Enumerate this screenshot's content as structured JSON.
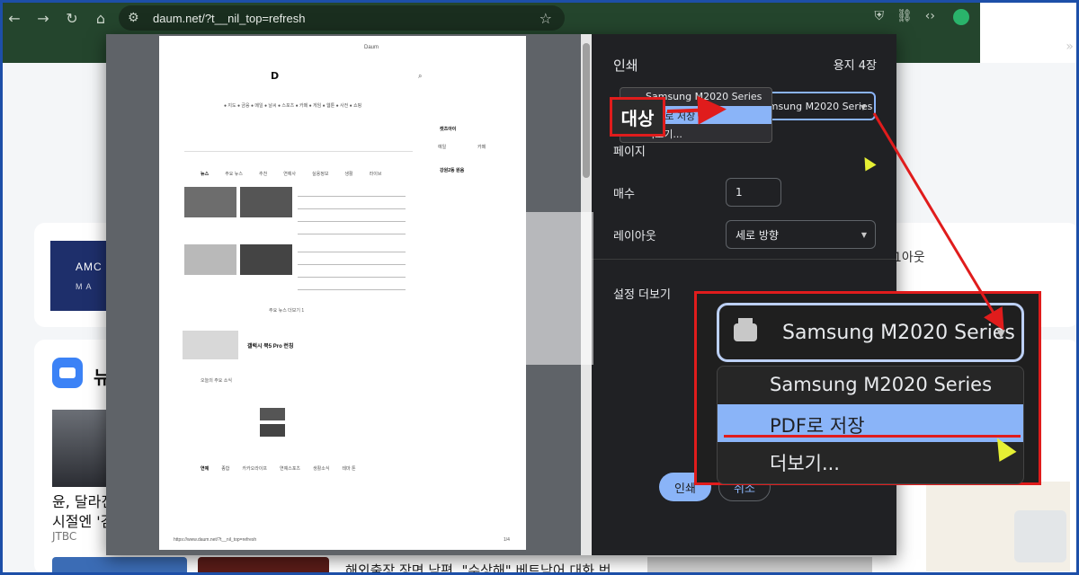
{
  "browser": {
    "url": "daum.net/?t__nil_top=refresh",
    "more_label": "»"
  },
  "background_page": {
    "ad_logo": "AMC",
    "ad_logo_sub": "M A",
    "news_section_label": "뉴",
    "headline": "윤, 달라진 시절엔 '검",
    "headline_line1": "윤, 달라진",
    "headline_line2": "시절엔 '검",
    "source": "JTBC",
    "layout_text": "1아웃",
    "bottom_title": "해외출장 장면 남편, \"수상해\" 베트남어 대화 번..."
  },
  "print_preview": {
    "header": "Daum",
    "logo": "D",
    "tabs": [
      "뉴스",
      "주요 뉴스",
      "추천",
      "연예사",
      "실용정보",
      "생활",
      "라이브"
    ],
    "side_title": "캣츠아이",
    "side_tab1": "예일",
    "side_tab2": "카페",
    "side_item": "강원2동 원음",
    "news_more": "주요 뉴스 더보기 1",
    "promo_title": "갤럭시 북5 Pro 런칭",
    "section_title": "오늘의 주요 소식",
    "bottom_tabs": [
      "연예",
      "종합",
      "카카오라이프",
      "연예스포츠",
      "생활소식",
      "테마 톤"
    ],
    "footer_url": "https://www.daum.net/?t__nil_top=refresh",
    "footer_page": "1/4"
  },
  "print_settings": {
    "title": "인쇄",
    "pages_count": "용지 4장",
    "destination_label": "대상",
    "destination_value": "Samsung M2020 Series",
    "destination_options": [
      "Samsung M2020 Series",
      "PDF로 저장",
      "더보기..."
    ],
    "selected_option": "PDF로 저장",
    "pages_label": "페이지",
    "copies_label": "매수",
    "copies_value": "1",
    "layout_label": "레이아웃",
    "layout_value": "세로 방향",
    "more_settings_label": "설정 더보기",
    "print_button": "인쇄",
    "cancel_button": "취소"
  },
  "annotation": {
    "callout_label": "대상",
    "zoom_destination": "Samsung M2020 Series",
    "zoom_options": [
      "Samsung M2020 Series",
      "PDF로 저장",
      "더보기..."
    ],
    "accent_color": "#e01c1c"
  }
}
